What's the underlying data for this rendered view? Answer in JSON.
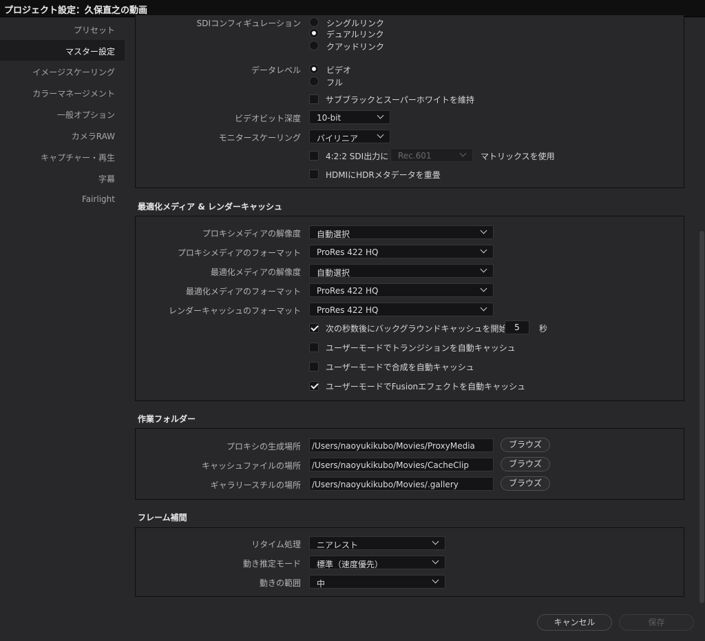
{
  "window": {
    "title": "プロジェクト設定：久保直之の動画"
  },
  "sidebar": {
    "items": [
      {
        "label": "プリセット"
      },
      {
        "label": "マスター設定"
      },
      {
        "label": "イメージスケーリング"
      },
      {
        "label": "カラーマネージメント"
      },
      {
        "label": "一般オプション"
      },
      {
        "label": "カメラRAW"
      },
      {
        "label": "キャプチャー・再生"
      },
      {
        "label": "字幕"
      },
      {
        "label": "Fairlight"
      }
    ],
    "active_index": 1
  },
  "video_monitoring": {
    "sdi_config": {
      "label": "SDIコンフィギュレーション",
      "options": [
        "シングルリンク",
        "デュアルリンク",
        "クアッドリンク"
      ],
      "selected": "デュアルリンク"
    },
    "data_level": {
      "label": "データレベル",
      "options": [
        "ビデオ",
        "フル"
      ],
      "selected": "ビデオ"
    },
    "retain_sub_black": {
      "label": "サブブラックとスーパーホワイトを維持",
      "checked": false
    },
    "bit_depth": {
      "label": "ビデオビット深度",
      "value": "10-bit"
    },
    "monitor_scaling": {
      "label": "モニタースケーリング",
      "value": "バイリニア"
    },
    "sdi_422": {
      "label": "4:2:2 SDI出力に",
      "checked": false,
      "matrix_value": "Rec.601",
      "suffix": "マトリックスを使用"
    },
    "hdmi_hdr": {
      "label": "HDMIにHDRメタデータを重畳",
      "checked": false
    }
  },
  "optimized_media": {
    "title": "最適化メディア & レンダーキャッシュ",
    "proxy_resolution": {
      "label": "プロキシメディアの解像度",
      "value": "自動選択"
    },
    "proxy_format": {
      "label": "プロキシメディアのフォーマット",
      "value": "ProRes 422 HQ"
    },
    "optimized_resolution": {
      "label": "最適化メディアの解像度",
      "value": "自動選択"
    },
    "optimized_format": {
      "label": "最適化メディアのフォーマット",
      "value": "ProRes 422 HQ"
    },
    "render_cache_format": {
      "label": "レンダーキャッシュのフォーマット",
      "value": "ProRes 422 HQ"
    },
    "bg_cache": {
      "label": "次の秒数後にバックグラウンドキャッシュを開始",
      "checked": true,
      "seconds": "5",
      "unit": "秒"
    },
    "auto_cache_transitions": {
      "label": "ユーザーモードでトランジションを自動キャッシュ",
      "checked": false
    },
    "auto_cache_composites": {
      "label": "ユーザーモードで合成を自動キャッシュ",
      "checked": false
    },
    "auto_cache_fusion": {
      "label": "ユーザーモードでFusionエフェクトを自動キャッシュ",
      "checked": true
    }
  },
  "working_folders": {
    "title": "作業フォルダー",
    "browse_label": "ブラウズ",
    "proxy_location": {
      "label": "プロキシの生成場所",
      "value": "/Users/naoyukikubo/Movies/ProxyMedia"
    },
    "cache_location": {
      "label": "キャッシュファイルの場所",
      "value": "/Users/naoyukikubo/Movies/CacheClip"
    },
    "gallery_location": {
      "label": "ギャラリースチルの場所",
      "value": "/Users/naoyukikubo/Movies/.gallery"
    }
  },
  "frame_interpolation": {
    "title": "フレーム補間",
    "retime_process": {
      "label": "リタイム処理",
      "value": "ニアレスト"
    },
    "motion_estimation": {
      "label": "動き推定モード",
      "value": "標準（速度優先）"
    },
    "motion_range": {
      "label": "動きの範囲",
      "value": "中"
    }
  },
  "footer": {
    "cancel_label": "キャンセル",
    "save_label": "保存"
  }
}
